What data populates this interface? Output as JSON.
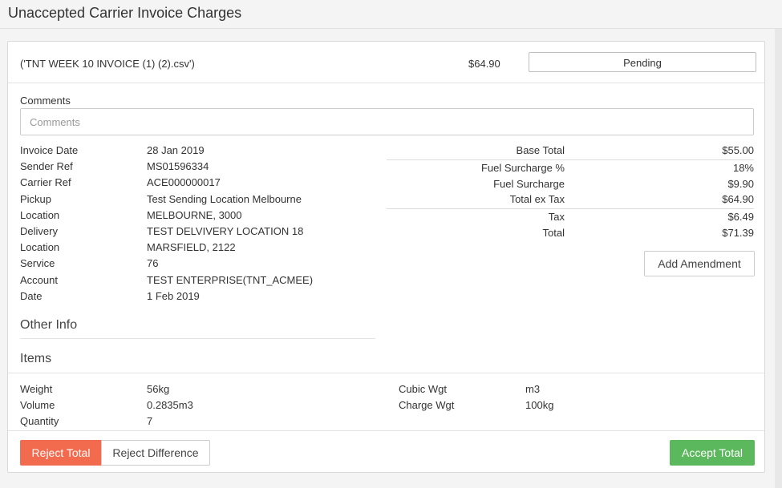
{
  "page": {
    "title": "Unaccepted Carrier Invoice Charges"
  },
  "header": {
    "file_name": "('TNT WEEK 10 INVOICE (1) (2).csv')",
    "amount": "$64.90",
    "status": "Pending"
  },
  "comments": {
    "label": "Comments",
    "placeholder": "Comments",
    "value": ""
  },
  "details": [
    {
      "label": "Invoice Date",
      "value": "28 Jan 2019"
    },
    {
      "label": "Sender Ref",
      "value": "MS01596334"
    },
    {
      "label": "Carrier Ref",
      "value": "ACE000000017"
    },
    {
      "label": "Pickup",
      "value": "Test Sending Location Melbourne"
    },
    {
      "label": "Location",
      "value": "MELBOURNE, 3000"
    },
    {
      "label": "Delivery",
      "value": "TEST DELVIVERY LOCATION 18"
    },
    {
      "label": "Location",
      "value": "MARSFIELD, 2122"
    },
    {
      "label": "Service",
      "value": "76"
    },
    {
      "label": "Account",
      "value": "TEST ENTERPRISE(TNT_ACMEE)"
    },
    {
      "label": "Date",
      "value": "1 Feb 2019"
    }
  ],
  "totals": [
    {
      "label": "Base Total",
      "value": "$55.00"
    },
    {
      "label": "Fuel Surcharge %",
      "value": "18%"
    },
    {
      "label": "Fuel Surcharge",
      "value": "$9.90"
    },
    {
      "label": "Total ex Tax",
      "value": "$64.90"
    },
    {
      "label": "Tax",
      "value": "$6.49"
    },
    {
      "label": "Total",
      "value": "$71.39"
    }
  ],
  "add_amendment_label": "Add Amendment",
  "sections": {
    "other_info": "Other Info",
    "items": "Items"
  },
  "items": {
    "left": [
      {
        "label": "Weight",
        "value": "56kg"
      },
      {
        "label": "Volume",
        "value": "0.2835m3"
      },
      {
        "label": "Quantity",
        "value": "7"
      }
    ],
    "right": [
      {
        "label": "Cubic Wgt",
        "value": "m3"
      },
      {
        "label": "Charge Wgt",
        "value": "100kg"
      }
    ]
  },
  "actions": {
    "reject_total": "Reject Total",
    "reject_difference": "Reject Difference",
    "accept_total": "Accept Total"
  },
  "colors": {
    "reject": "#f26b4e",
    "accept": "#5cb85c"
  }
}
